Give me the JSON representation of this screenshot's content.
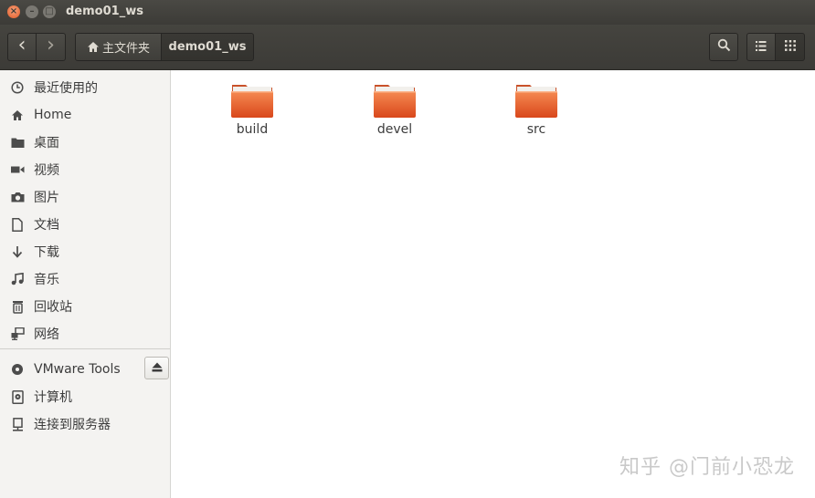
{
  "window": {
    "title": "demo01_ws",
    "controls": {
      "close": "×",
      "minimize": "–",
      "maximize": "□"
    }
  },
  "toolbar": {
    "back_icon": "‹",
    "forward_icon": "›",
    "breadcrumb": {
      "home_label": "主文件夹",
      "current": "demo01_ws"
    }
  },
  "sidebar": {
    "places": [
      {
        "icon": "clock-icon",
        "label": "最近使用的"
      },
      {
        "icon": "home-icon",
        "label": "Home"
      },
      {
        "icon": "desktop-folder-icon",
        "label": "桌面"
      },
      {
        "icon": "video-icon",
        "label": "视频"
      },
      {
        "icon": "camera-icon",
        "label": "图片"
      },
      {
        "icon": "document-icon",
        "label": "文档"
      },
      {
        "icon": "download-icon",
        "label": "下载"
      },
      {
        "icon": "music-icon",
        "label": "音乐"
      },
      {
        "icon": "trash-icon",
        "label": "回收站"
      },
      {
        "icon": "network-icon",
        "label": "网络"
      }
    ],
    "devices": [
      {
        "icon": "disc-icon",
        "label": "VMware Tools"
      },
      {
        "icon": "computer-icon",
        "label": "计算机"
      },
      {
        "icon": "server-icon",
        "label": "连接到服务器"
      }
    ]
  },
  "main": {
    "folders": [
      {
        "name": "build"
      },
      {
        "name": "devel"
      },
      {
        "name": "src"
      }
    ]
  },
  "watermark": "知乎 @门前小恐龙",
  "colors": {
    "titlebar": "#3c3b37",
    "folder": "#e8622a",
    "sidebar": "#f4f3f1"
  }
}
